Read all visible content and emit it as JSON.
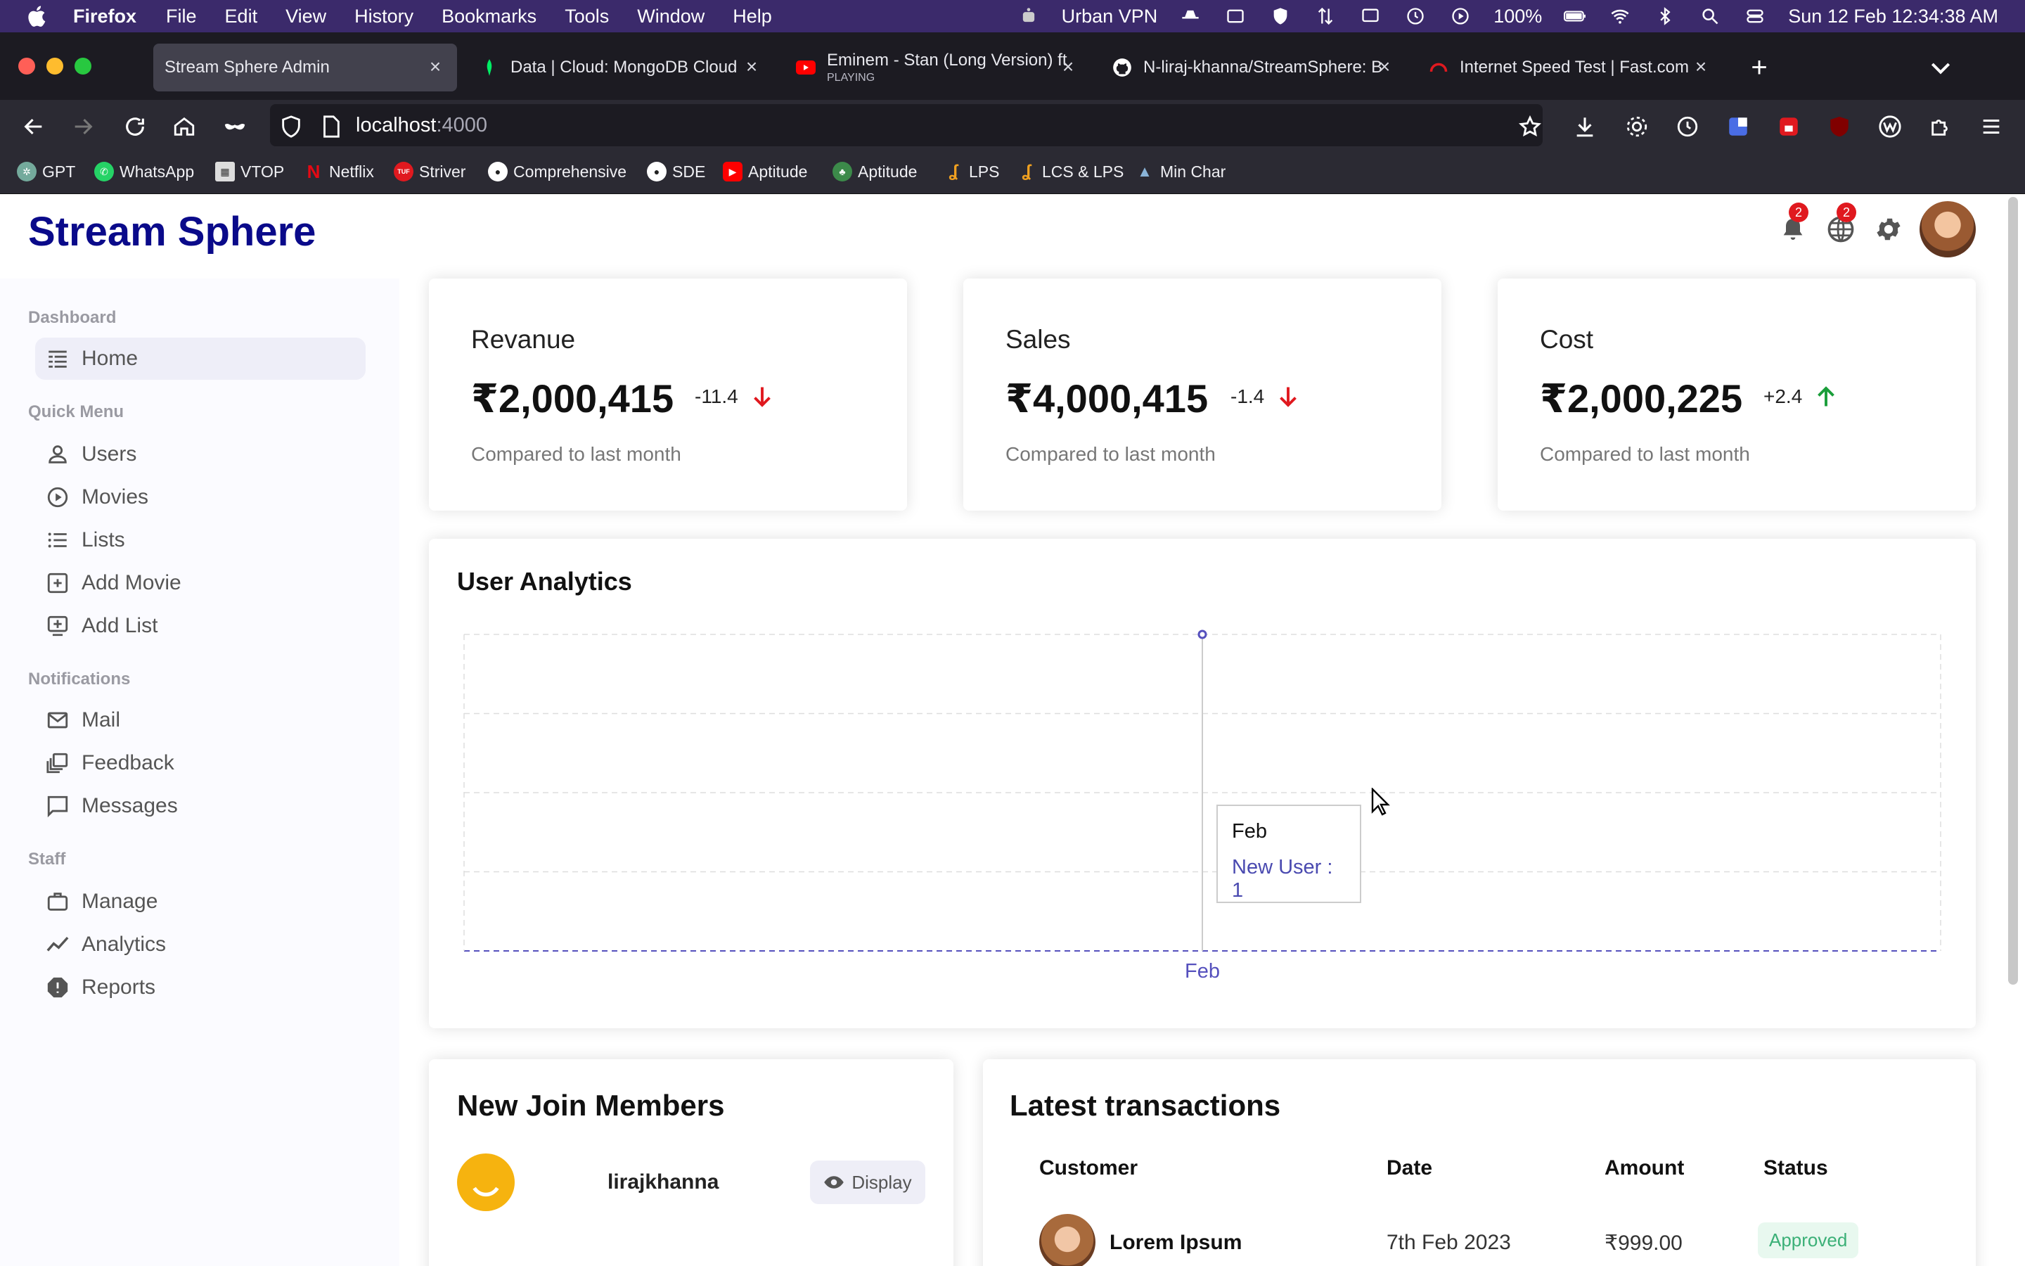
{
  "menubar": {
    "app": "Firefox",
    "menus": [
      "File",
      "Edit",
      "View",
      "History",
      "Bookmarks",
      "Tools",
      "Window",
      "Help"
    ],
    "vpn": "Urban VPN",
    "battery": "100%",
    "clock": "Sun 12 Feb  12:34:38 AM"
  },
  "tabs": [
    {
      "title": "Stream Sphere Admin",
      "active": true
    },
    {
      "title": "Data | Cloud: MongoDB Cloud"
    },
    {
      "title": "Eminem - Stan (Long Version) ft",
      "sub": "PLAYING"
    },
    {
      "title": "N-liraj-khanna/StreamSphere: B"
    },
    {
      "title": "Internet Speed Test | Fast.com"
    }
  ],
  "url": {
    "host": "localhost",
    "port": ":4000"
  },
  "bookmarks": [
    "GPT",
    "WhatsApp",
    "VTOP",
    "Netflix",
    "Striver",
    "Comprehensive",
    "SDE",
    "Aptitude",
    "Aptitude",
    "LPS",
    "LCS & LPS",
    "Min Char"
  ],
  "header": {
    "logo": "Stream Sphere",
    "notif_badge": "2",
    "lang_badge": "2"
  },
  "sidebar": {
    "sections": [
      "Dashboard",
      "Quick Menu",
      "Notifications",
      "Staff"
    ],
    "items": [
      "Home",
      "Users",
      "Movies",
      "Lists",
      "Add Movie",
      "Add List",
      "Mail",
      "Feedback",
      "Messages",
      "Manage",
      "Analytics",
      "Reports"
    ]
  },
  "featured": [
    {
      "title": "Revanue",
      "money": "₹2,000,415",
      "rate": "-11.4",
      "direction": "down",
      "sub": "Compared to last month"
    },
    {
      "title": "Sales",
      "money": "₹4,000,415",
      "rate": "-1.4",
      "direction": "down",
      "sub": "Compared to last month"
    },
    {
      "title": "Cost",
      "money": "₹2,000,225",
      "rate": "+2.4",
      "direction": "up",
      "sub": "Compared to last month"
    }
  ],
  "chart": {
    "title": "User Analytics",
    "tooltip_label": "Feb",
    "tooltip_value": "New User : 1"
  },
  "chart_data": {
    "type": "line",
    "title": "User Analytics",
    "categories": [
      "Feb"
    ],
    "series": [
      {
        "name": "New User",
        "values": [
          1
        ]
      }
    ],
    "grid": true
  },
  "members": {
    "title": "New Join Members",
    "list": [
      {
        "name": "lirajkhanna",
        "button": "Display"
      }
    ]
  },
  "transactions": {
    "title": "Latest transactions",
    "headers": [
      "Customer",
      "Date",
      "Amount",
      "Status"
    ],
    "rows": [
      {
        "customer": "Lorem Ipsum",
        "date": "7th Feb 2023",
        "amount": "₹999.00",
        "status": "Approved"
      }
    ]
  },
  "colors": {
    "logo": "#0a0a8a",
    "chart_line": "#5550bd",
    "down": "#e0191f",
    "up": "#1a9e3a",
    "approved": "#3bb077"
  }
}
